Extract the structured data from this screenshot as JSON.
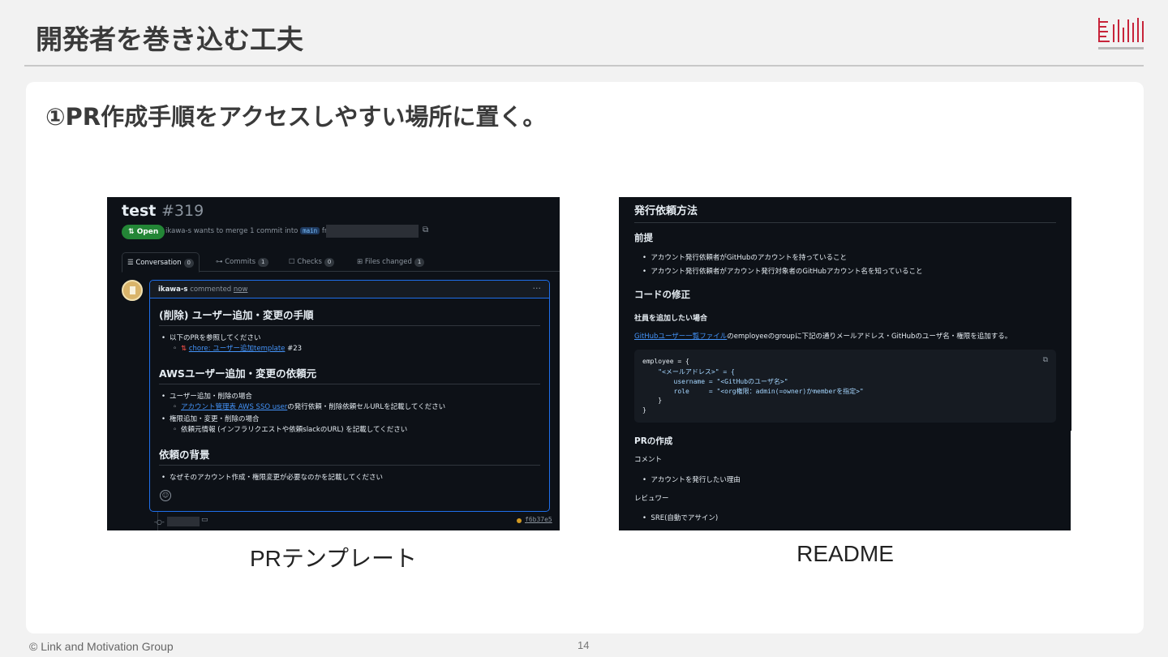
{
  "slide": {
    "title": "開発者を巻き込む工夫",
    "heading": "①PR作成手順をアクセスしやすい場所に置く。",
    "footer": "© Link and Motivation Group",
    "page_number": "14",
    "accent_color": "#c7243a"
  },
  "captions": {
    "left": "PRテンプレート",
    "right": "README"
  },
  "pr": {
    "title": "test",
    "number": "#319",
    "status": "Open",
    "meta_prefix": "ikawa-s wants to merge 1 commit into",
    "base_branch": "main",
    "meta_from": "from",
    "tabs": [
      {
        "label": "Conversation",
        "count": "0"
      },
      {
        "label": "Commits",
        "count": "1"
      },
      {
        "label": "Checks",
        "count": "0"
      },
      {
        "label": "Files changed",
        "count": "1"
      }
    ],
    "comment": {
      "author": "ikawa-s",
      "action": "commented",
      "time": "now",
      "sections": [
        {
          "heading": "(削除) ユーザー追加・変更の手順",
          "items": [
            {
              "text": "以下のPRを参照してください"
            },
            {
              "link": "chore: ユーザー追加template",
              "suffix": "#23"
            }
          ]
        },
        {
          "heading": "AWSユーザー追加・変更の依頼元",
          "items": [
            {
              "text": "ユーザー追加・削除の場合"
            },
            {
              "link": "アカウント管理表 AWS SSO user",
              "suffix": "の発行依頼・削除依頼セルURLを記載してください"
            },
            {
              "text": "権限追加・変更・削除の場合"
            },
            {
              "text": "依頼元情報 (インフラリクエストや依頼slackのURL) を記載してください"
            }
          ]
        },
        {
          "heading": "依頼の背景",
          "items": [
            {
              "text": "なぜそのアカウント作成・権限変更が必要なのかを記載してください"
            }
          ]
        }
      ]
    },
    "commit_sha": "f6b37e5"
  },
  "readme": {
    "h2": "発行依頼方法",
    "premise_heading": "前提",
    "premise_items": [
      "アカウント発行依頼者がGitHubのアカウントを持っていること",
      "アカウント発行依頼者がアカウント発行対象者のGitHubアカウント名を知っていること"
    ],
    "code_fix_heading": "コードの修正",
    "add_employee_heading": "社員を追加したい場合",
    "instruction_link": "GitHubユーザー一覧ファイル",
    "instruction_text": "のemployeeのgroupに下記の通りメールアドレス・GitHubのユーザ名・権限を追加する。",
    "code_lines": [
      "employee = {",
      "    \"<メールアドレス>\" = {",
      "        username = \"<GitHubのユーザ名>\"",
      "        role     = \"<org権限：admin(=owner)かmemberを指定>\"",
      "    }",
      "}"
    ],
    "pr_heading": "PRの作成",
    "comment_label": "コメント",
    "comment_item": "アカウントを発行したい理由",
    "reviewer_label": "レビュワー",
    "reviewer_item": "SRE(自動でアサイン)"
  }
}
